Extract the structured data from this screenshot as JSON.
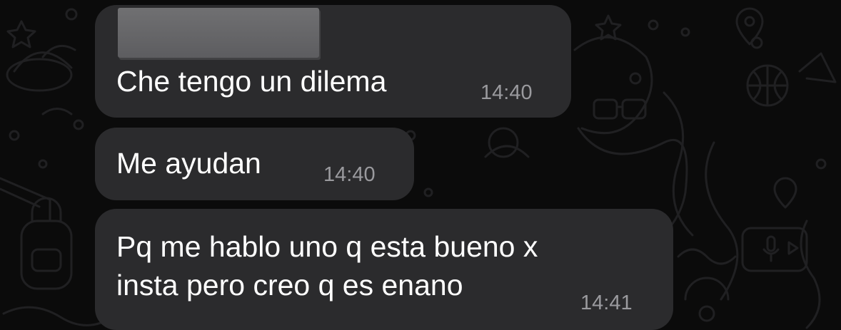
{
  "chat": {
    "messages": [
      {
        "text": "Che tengo un dilema",
        "time": "14:40",
        "has_redacted_quote": true
      },
      {
        "text": "Me ayudan",
        "time": "14:40"
      },
      {
        "text": "Pq me hablo uno q esta bueno x\ninsta pero creo q es enano",
        "time": "14:41"
      }
    ]
  },
  "colors": {
    "background": "#0b0b0b",
    "bubble": "#2b2b2d",
    "text": "#ffffff",
    "timestamp": "#9a9a9e",
    "doodle_stroke": "#202022"
  },
  "icons": [
    "star-icon",
    "circle-icon",
    "basketball-icon",
    "sunglasses-icon",
    "microphone-icon",
    "play-icon",
    "location-pin-icon",
    "backpack-icon",
    "doodle-wallpaper"
  ]
}
